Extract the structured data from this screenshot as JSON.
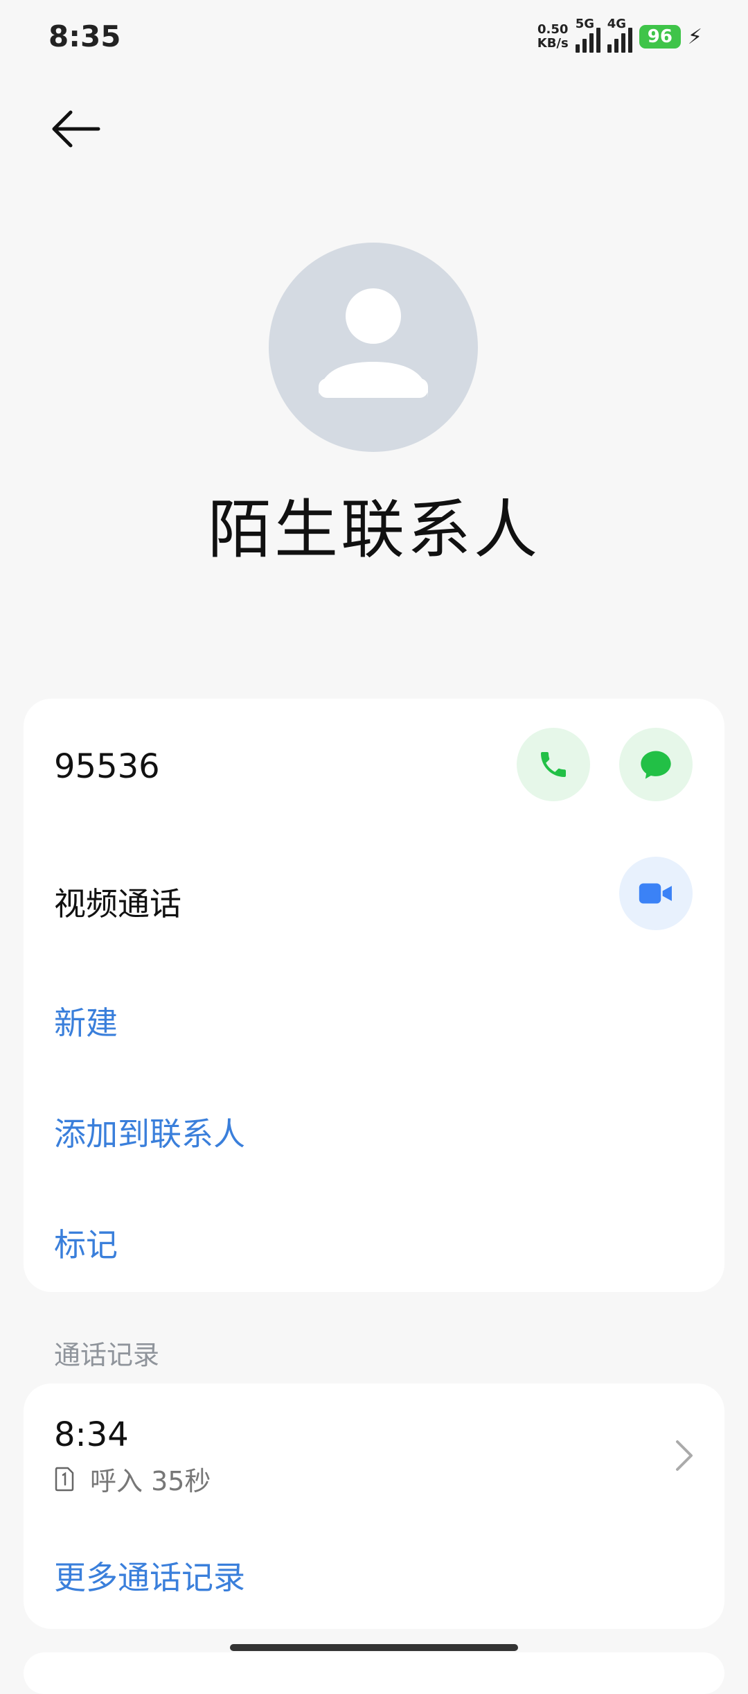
{
  "status_bar": {
    "time": "8:35",
    "net_speed_value": "0.50",
    "net_speed_unit": "KB/s",
    "sig1_label": "5G",
    "sig2_label": "4G",
    "battery": "96",
    "battery_color": "#3fc449"
  },
  "header": {
    "back_icon": "arrow-left-icon"
  },
  "contact": {
    "avatar_icon": "person-icon",
    "name": "陌生联系人"
  },
  "info_card": {
    "phone_number": "95536",
    "call_icon": "phone-icon",
    "message_icon": "message-icon",
    "video_label": "视频通话",
    "video_icon": "video-camera-icon",
    "actions": {
      "new": "新建",
      "add_to_contacts": "添加到联系人",
      "mark": "标记"
    }
  },
  "call_log": {
    "section_title": "通话记录",
    "entries": [
      {
        "time": "8:34",
        "sim_icon": "sim-1-icon",
        "detail": "呼入 35秒"
      }
    ],
    "more_label": "更多通话记录"
  },
  "colors": {
    "accent": "#3a7fdb",
    "green": "#22c046",
    "video_blue": "#3b82f6"
  }
}
